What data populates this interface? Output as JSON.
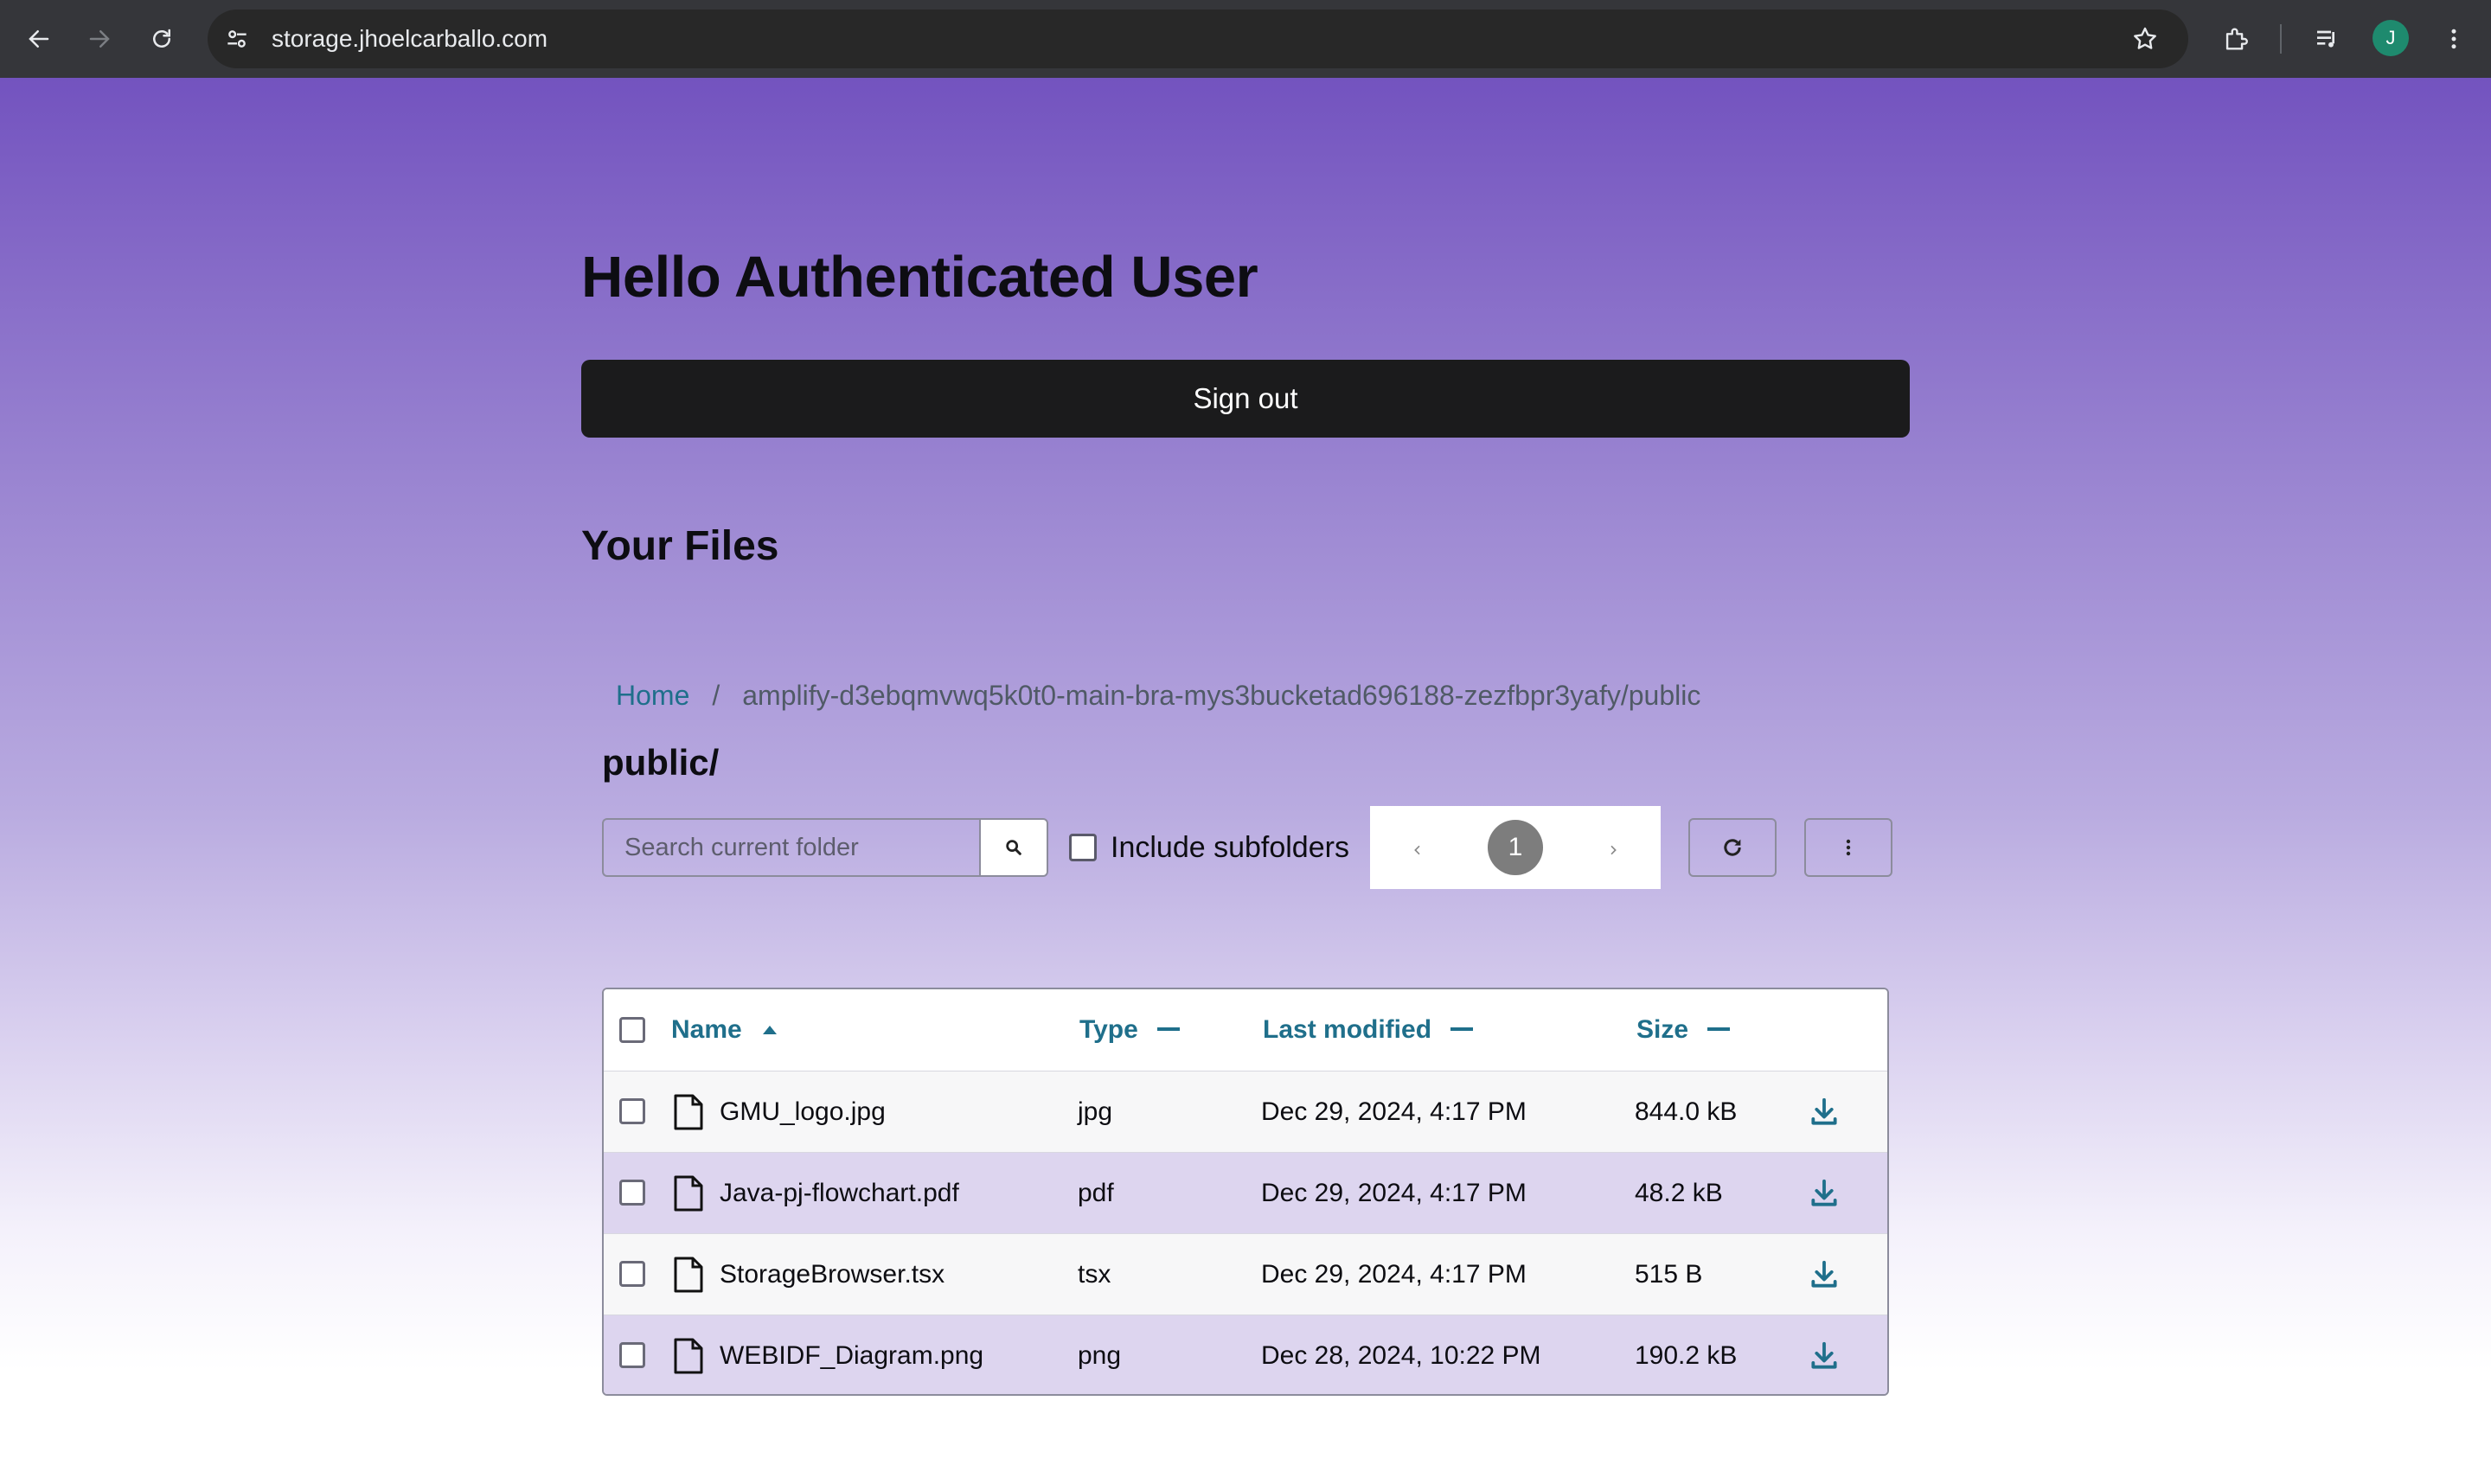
{
  "browser": {
    "url": "storage.jhoelcarballo.com",
    "avatar_initial": "J"
  },
  "page": {
    "greeting": "Hello Authenticated User",
    "signout_label": "Sign out",
    "files_title": "Your Files"
  },
  "browser_panel": {
    "breadcrumb_home": "Home",
    "breadcrumb_separator": "/",
    "breadcrumb_path": "amplify-d3ebqmvwq5k0t0-main-bra-mys3bucketad696188-zezfbpr3yafy/public",
    "folder_title": "public/",
    "search_placeholder": "Search current folder",
    "include_subfolders_label": "Include subfolders",
    "current_page": "1"
  },
  "table": {
    "columns": {
      "name": "Name",
      "type": "Type",
      "modified": "Last modified",
      "size": "Size"
    },
    "rows": [
      {
        "name": "GMU_logo.jpg",
        "type": "jpg",
        "modified": "Dec 29, 2024, 4:17 PM",
        "size": "844.0 kB"
      },
      {
        "name": "Java-pj-flowchart.pdf",
        "type": "pdf",
        "modified": "Dec 29, 2024, 4:17 PM",
        "size": "48.2 kB"
      },
      {
        "name": "StorageBrowser.tsx",
        "type": "tsx",
        "modified": "Dec 29, 2024, 4:17 PM",
        "size": "515 B"
      },
      {
        "name": "WEBIDF_Diagram.png",
        "type": "png",
        "modified": "Dec 28, 2024, 10:22 PM",
        "size": "190.2 kB"
      }
    ]
  },
  "colors": {
    "accent": "#1f6f8b",
    "gradient_top": "#7353bf",
    "signout_bg": "#1b1b1c"
  }
}
